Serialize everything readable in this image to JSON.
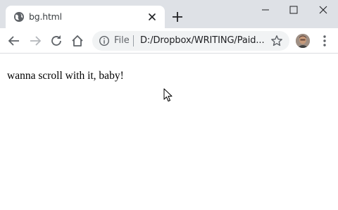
{
  "tab": {
    "title": "bg.html",
    "icon": "globe-icon"
  },
  "toolbar": {
    "scheme_label": "File",
    "url": "D:/Dropbox/WRITING/Paid..."
  },
  "page": {
    "text": "wanna scroll with it, baby!"
  },
  "colors": {
    "titlebar": "#dee1e6",
    "omnibox": "#f1f3f4",
    "icon": "#5f6368",
    "text": "#000000"
  }
}
